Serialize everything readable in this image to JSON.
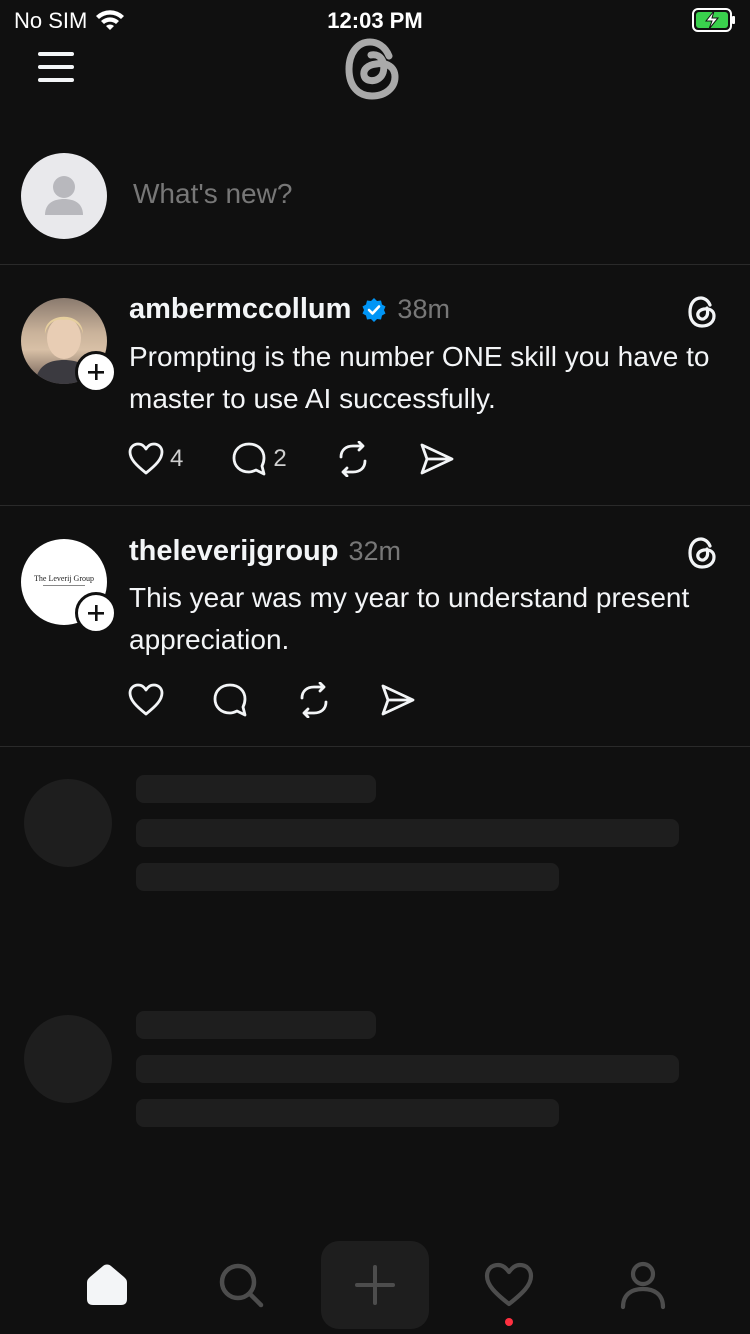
{
  "status_bar": {
    "carrier": "No SIM",
    "time": "12:03 PM"
  },
  "compose": {
    "placeholder": "What's new?"
  },
  "posts": [
    {
      "username": "ambermccollum",
      "verified": true,
      "time_ago": "38m",
      "text": "Prompting is the number ONE skill you have to master to use AI successfully.",
      "likes": "4",
      "replies": "2"
    },
    {
      "username": "theleverijgroup",
      "verified": false,
      "time_ago": "32m",
      "text": "This year was my year to understand present appreciation.",
      "avatar_logo_text": "The Leverij Group"
    }
  ],
  "tab_bar": {
    "tabs": [
      "home-icon",
      "search-icon",
      "plus-icon",
      "heart-icon",
      "profile-icon"
    ],
    "active": "home-icon",
    "notification_dot_color": "#ff3040"
  },
  "colors": {
    "background": "#101010",
    "verified": "#0095f6",
    "muted": "#777777"
  }
}
